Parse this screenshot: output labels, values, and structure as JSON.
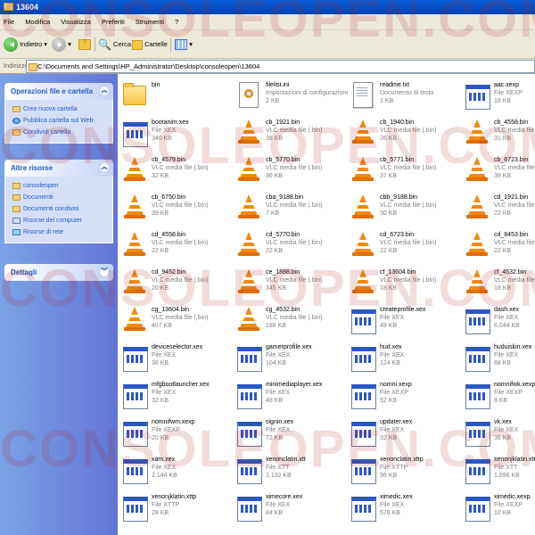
{
  "window": {
    "title": "13604"
  },
  "menu": [
    "File",
    "Modifica",
    "Visualizza",
    "Preferiti",
    "Strumenti",
    "?"
  ],
  "toolbar": {
    "back": "Indietro",
    "search": "Cerca",
    "folders": "Cartelle"
  },
  "address": {
    "label": "Indirizzo",
    "path": "C:\\Documents and Settings\\HP_Administrator\\Desktop\\consoleopen\\13604"
  },
  "sidebar": {
    "tasks_title": "Operazioni file e cartella",
    "tasks": [
      "Crea nuova cartella",
      "Pubblica cartella sul Web",
      "Condividi cartella"
    ],
    "places_title": "Altre risorse",
    "places": [
      "consoleopen",
      "Documenti",
      "Documenti condivisi",
      "Risorse del computer",
      "Risorse di rete"
    ],
    "details_title": "Dettagli"
  },
  "watermark": "CONSOLEOPEN.COM",
  "files": [
    {
      "name": "bin",
      "type": "",
      "size": "",
      "icon": "folder"
    },
    {
      "name": "filelist.ini",
      "type": "Impostazioni di configurazione",
      "size": "2 KB",
      "icon": "ini"
    },
    {
      "name": "readme.txt",
      "type": "Documento di testo",
      "size": "1 KB",
      "icon": "doc"
    },
    {
      "name": "aac.xexp",
      "type": "File XEXP",
      "size": "18 KB",
      "icon": "exe"
    },
    {
      "name": "bootanim.xex",
      "type": "File XEX",
      "size": "340 KB",
      "icon": "exe"
    },
    {
      "name": "cb_1921.bin",
      "type": "VLC media file (.bin)",
      "size": "38 KB",
      "icon": "vlc"
    },
    {
      "name": "cb_1940.bin",
      "type": "VLC media file (.bin)",
      "size": "26 KB",
      "icon": "vlc"
    },
    {
      "name": "cb_4558.bin",
      "type": "VLC media file (.bin)",
      "size": "31 KB",
      "icon": "vlc"
    },
    {
      "name": "cb_4579.bin",
      "type": "VLC media file (.bin)",
      "size": "32 KB",
      "icon": "vlc"
    },
    {
      "name": "cb_5770.bin",
      "type": "VLC media file (.bin)",
      "size": "36 KB",
      "icon": "vlc"
    },
    {
      "name": "cb_5771.bin",
      "type": "VLC media file (.bin)",
      "size": "37 KB",
      "icon": "vlc"
    },
    {
      "name": "cb_6723.bin",
      "type": "VLC media file (.bin)",
      "size": "38 KB",
      "icon": "vlc"
    },
    {
      "name": "cb_6750.bin",
      "type": "VLC media file (.bin)",
      "size": "39 KB",
      "icon": "vlc"
    },
    {
      "name": "cba_9188.bin",
      "type": "VLC media file (.bin)",
      "size": "7 KB",
      "icon": "vlc"
    },
    {
      "name": "cbb_9188.bin",
      "type": "VLC media file (.bin)",
      "size": "30 KB",
      "icon": "vlc"
    },
    {
      "name": "cd_1921.bin",
      "type": "VLC media file (.bin)",
      "size": "22 KB",
      "icon": "vlc"
    },
    {
      "name": "cd_4558.bin",
      "type": "VLC media file (.bin)",
      "size": "22 KB",
      "icon": "vlc"
    },
    {
      "name": "cd_5770.bin",
      "type": "VLC media file (.bin)",
      "size": "22 KB",
      "icon": "vlc"
    },
    {
      "name": "cd_6723.bin",
      "type": "VLC media file (.bin)",
      "size": "22 KB",
      "icon": "vlc"
    },
    {
      "name": "cd_8453.bin",
      "type": "VLC media file (.bin)",
      "size": "22 KB",
      "icon": "vlc"
    },
    {
      "name": "cd_9452.bin",
      "type": "VLC media file (.bin)",
      "size": "20 KB",
      "icon": "vlc"
    },
    {
      "name": "ce_1888.bin",
      "type": "VLC media file (.bin)",
      "size": "345 KB",
      "icon": "vlc"
    },
    {
      "name": "cf_13604.bin",
      "type": "VLC media file (.bin)",
      "size": "18 KB",
      "icon": "vlc"
    },
    {
      "name": "cf_4532.bin",
      "type": "VLC media file (.bin)",
      "size": "18 KB",
      "icon": "vlc"
    },
    {
      "name": "cg_13604.bin",
      "type": "VLC media file (.bin)",
      "size": "407 KB",
      "icon": "vlc"
    },
    {
      "name": "cg_4532.bin",
      "type": "VLC media file (.bin)",
      "size": "188 KB",
      "icon": "vlc"
    },
    {
      "name": "createprofile.xex",
      "type": "File XEX",
      "size": "48 KB",
      "icon": "exe"
    },
    {
      "name": "dash.xex",
      "type": "File XEX",
      "size": "6.044 KB",
      "icon": "exe"
    },
    {
      "name": "deviceselector.xex",
      "type": "File XEX",
      "size": "36 KB",
      "icon": "exe"
    },
    {
      "name": "gamerprofile.xex",
      "type": "File XEX",
      "size": "104 KB",
      "icon": "exe"
    },
    {
      "name": "hud.xex",
      "type": "File XEX",
      "size": "124 KB",
      "icon": "exe"
    },
    {
      "name": "huduiskin.xex",
      "type": "File XEX",
      "size": "68 KB",
      "icon": "exe"
    },
    {
      "name": "mfgbootlauncher.xex",
      "type": "File XEX",
      "size": "32 KB",
      "icon": "exe"
    },
    {
      "name": "minimediaplayer.xex",
      "type": "File XEX",
      "size": "48 KB",
      "icon": "exe"
    },
    {
      "name": "nomni.xexp",
      "type": "File XEXP",
      "size": "52 KB",
      "icon": "exe"
    },
    {
      "name": "nomnifwk.xexp",
      "type": "File XEXP",
      "size": "8 KB",
      "icon": "exe"
    },
    {
      "name": "nomnifwm.xexp",
      "type": "File XEXP",
      "size": "20 KB",
      "icon": "exe"
    },
    {
      "name": "signin.xex",
      "type": "File XEX",
      "size": "72 KB",
      "icon": "exe"
    },
    {
      "name": "updater.xex",
      "type": "File XEX",
      "size": "32 KB",
      "icon": "exe"
    },
    {
      "name": "vk.xex",
      "type": "File XEX",
      "size": "36 KB",
      "icon": "exe"
    },
    {
      "name": "xam.xex",
      "type": "File XEX",
      "size": "2.144 KB",
      "icon": "exe"
    },
    {
      "name": "xenonclatin.xtt",
      "type": "File XTT",
      "size": "1.132 KB",
      "icon": "exe"
    },
    {
      "name": "xenonclatin.xttp",
      "type": "File XTTP",
      "size": "96 KB",
      "icon": "exe"
    },
    {
      "name": "xenonjklatin.xtt",
      "type": "File XTT",
      "size": "1.696 KB",
      "icon": "exe"
    },
    {
      "name": "xenonjklatin.xttp",
      "type": "File XTTP",
      "size": "28 KB",
      "icon": "exe"
    },
    {
      "name": "ximecore.xex",
      "type": "File XEX",
      "size": "84 KB",
      "icon": "exe"
    },
    {
      "name": "ximedic.xex",
      "type": "File XEX",
      "size": "576 KB",
      "icon": "exe"
    },
    {
      "name": "ximedic.xexp",
      "type": "File XEXP",
      "size": "10 KB",
      "icon": "exe"
    }
  ]
}
